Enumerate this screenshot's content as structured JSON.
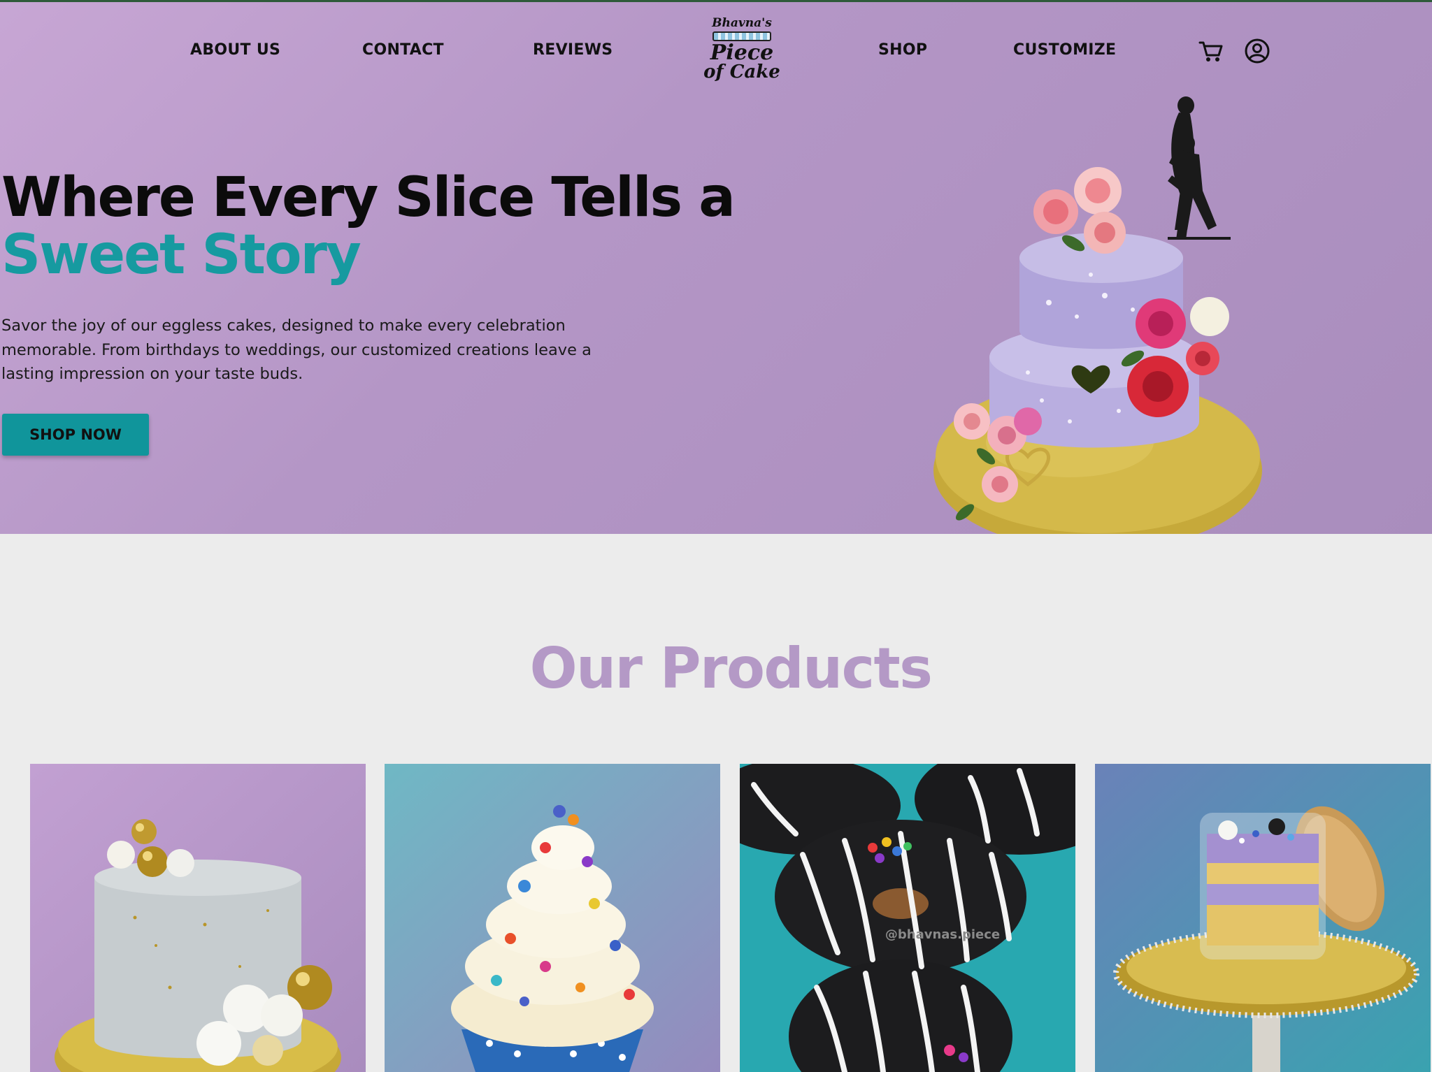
{
  "nav": {
    "links": [
      "ABOUT US",
      "CONTACT",
      "REVIEWS",
      "SHOP",
      "CUSTOMIZE"
    ],
    "logo": {
      "line1": "Bhavna's",
      "line2": "Piece",
      "line3": "of Cake"
    },
    "icons": [
      "cart-icon",
      "user-account-icon"
    ]
  },
  "hero": {
    "headline_line1": "Where Every Slice Tells a",
    "headline_line2": "Sweet Story",
    "description": "Savor the joy of our eggless cakes, designed to make every celebration memorable. From birthdays to weddings, our customized creations leave a lasting impression on your taste buds.",
    "cta": "SHOP NOW"
  },
  "products": {
    "title": "Our Products",
    "watermark": "@bhavnas.piece",
    "cards": [
      {
        "image": "gray-gold-cake"
      },
      {
        "image": "sprinkle-cupcake"
      },
      {
        "image": "striped-donuts"
      },
      {
        "image": "cake-jar"
      }
    ]
  },
  "colors": {
    "hero_bg": "#b99bca",
    "accent_teal": "#169aa0",
    "products_title": "#b499c6",
    "page_bg": "#ececec"
  }
}
